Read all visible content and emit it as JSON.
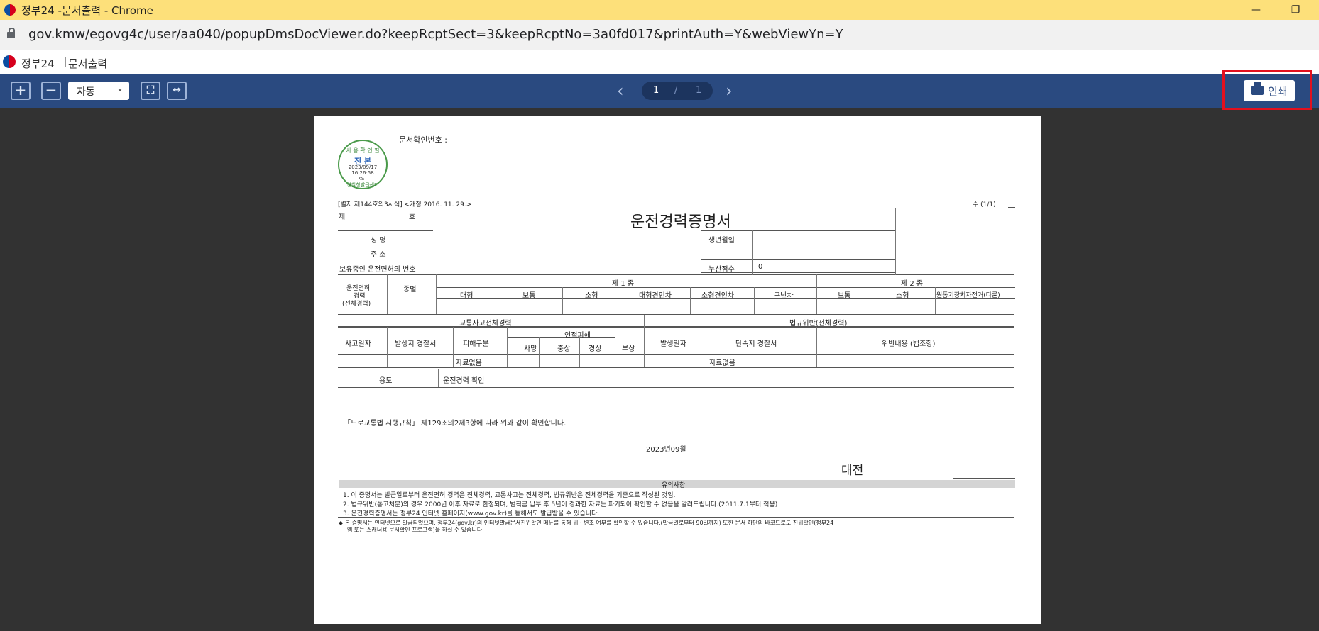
{
  "browser": {
    "window_title": "정부24 -문서출력 - Chrome",
    "url": "gov.kmw/egovg4c/user/aa040/popupDmsDocViewer.do?keepRcptSect=3&keepRcptNo=3a0fd017&printAuth=Y&webViewYn=Y",
    "minimize_glyph": "—",
    "restore_glyph": "❐"
  },
  "site": {
    "name": "정부24",
    "page_title": "문서출력"
  },
  "toolbar": {
    "zoom_in_glyph": "+",
    "zoom_out_glyph": "−",
    "zoom_value": "자동",
    "fit_page_glyph": "⛶",
    "fit_width_glyph": "↔",
    "prev_glyph": "‹",
    "next_glyph": "›",
    "current_page": "1",
    "page_sep": "/",
    "total_pages": "1",
    "print_label": "인쇄"
  },
  "accent": {
    "toolbar": "#2a4a80",
    "highlight": "#e3101e"
  },
  "document": {
    "confirm_no_label": "문서확인번호 :",
    "seal": {
      "top": "사 용 확 인 필",
      "main": "진 본",
      "date": "2023/09/17",
      "time": "16:26:58",
      "tz": "KST",
      "bottom": "경찰청발급센터"
    },
    "form_ref": "[별지 제144호의3서식] <개정 2016. 11. 29.>",
    "page_count": "수 (1/1)",
    "no_prefix": "제",
    "no_suffix": "호",
    "title": "운전경력증명서",
    "fields": {
      "name": "성      명",
      "address": "주      소",
      "license_no": "보유중인 운전면허의 번호",
      "birth": "생년월일",
      "points": "누산점수",
      "points_value": "0"
    },
    "license": {
      "row_label_1": "운전면허",
      "row_label_2": "경력",
      "row_label_3": "(전체경력)",
      "kind_label": "종별",
      "class1": "제 1 종",
      "class2": "제 2 종",
      "class1_items": [
        "대형",
        "보통",
        "소형",
        "대형견인차",
        "소형견인차",
        "구난차"
      ],
      "class2_items": [
        "보통",
        "소형",
        "원동기장치자전거(다륜)"
      ]
    },
    "accident": {
      "header": "교통사고전체경력",
      "date": "사고일자",
      "station": "발생지 경찰서",
      "type": "피해구분",
      "injury": "인적피해",
      "injury_items": [
        "사망",
        "중상",
        "경상",
        "부상"
      ],
      "no_data": "자료없음"
    },
    "violation": {
      "header": "법규위반(전체경력)",
      "date": "발생일자",
      "station": "단속지 경찰서",
      "content": "위반내용 (법조항)",
      "no_data": "자료없음"
    },
    "purpose_label": "용도",
    "purpose_value": "운전경력 확인",
    "confirm_text": "「도로교통법 시행규칙」 제129조의2제3항에 따라 위와 같이 확인합니다.",
    "issue_date": "2023년09월",
    "issuer": "대전",
    "notice_title": "유의사항",
    "notices": [
      "1. 이 증명서는 발급일로부터 운전면허 경력은 전체경력, 교통사고는 전체경력, 법규위반은 전체경력을 기준으로 작성된 것임.",
      "2. 법규위반(통고처분)의 경우 2000년 이후 자료로 한정되며, 범칙금 납부 후 5년이 경과한 자료는 파기되어 확인할 수 없음을 알려드립니다.(2011.7.1부터 적용)",
      "3. 운전경력증명서는 정부24 인터넷 홈페이지(www.gov.kr)를 통해서도 발급받을 수 있습니다."
    ],
    "footer_line1": "◆ 본 증명서는 인터넷으로 발급되었으며, 정부24(gov.kr)의 인터넷발급문서진위확인 메뉴를 통해 위 · 변조 여부를 확인할 수 있습니다.(발급일로부터 90일까지) 또한 문서 하단의 바코드로도 진위확인(정부24",
    "footer_line2": "앱 또는 스캐너용 문서확인 프로그램)을 하실 수 있습니다."
  }
}
